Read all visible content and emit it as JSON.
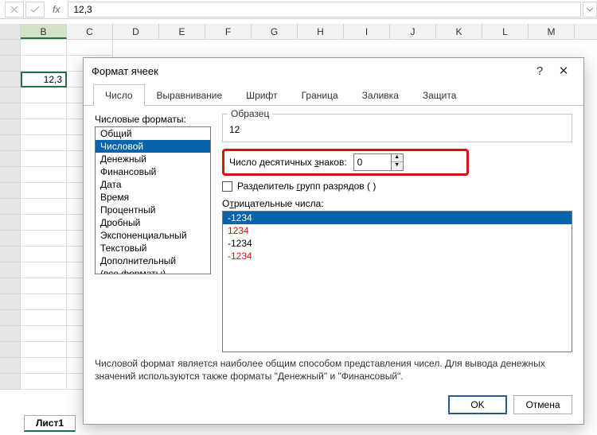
{
  "formula_bar": {
    "value": "12,3",
    "fx": "fx"
  },
  "columns": [
    "B",
    "C",
    "D",
    "E",
    "F",
    "G",
    "H",
    "I",
    "J",
    "K",
    "L",
    "M"
  ],
  "active_cell_value": "12,3",
  "sheet_tab": "Лист1",
  "dialog": {
    "title": "Формат ячеек",
    "help": "?",
    "close": "✕",
    "tabs": [
      "Число",
      "Выравнивание",
      "Шрифт",
      "Граница",
      "Заливка",
      "Защита"
    ],
    "active_tab": 0,
    "num_formats_label": "Числовые форматы:",
    "num_formats": [
      "Общий",
      "Числовой",
      "Денежный",
      "Финансовый",
      "Дата",
      "Время",
      "Процентный",
      "Дробный",
      "Экспоненциальный",
      "Текстовый",
      "Дополнительный",
      "(все форматы)"
    ],
    "num_formats_selected": 1,
    "sample_label": "Образец",
    "sample_value": "12",
    "decimal_label_pre": "Число десятичных ",
    "decimal_label_u": "з",
    "decimal_label_post": "наков:",
    "decimal_value": "0",
    "sep_label_pre": "Разделитель ",
    "sep_label_u": "г",
    "sep_label_post": "рупп разрядов ( )",
    "neg_label_pre": "О",
    "neg_label_u": "т",
    "neg_label_post": "рицательные числа:",
    "neg_items": [
      {
        "text": "-1234",
        "red": false,
        "sel": true
      },
      {
        "text": "1234",
        "red": true,
        "sel": false
      },
      {
        "text": "-1234",
        "red": false,
        "sel": false
      },
      {
        "text": "-1234",
        "red": true,
        "sel": false
      }
    ],
    "description": "Числовой формат является наиболее общим способом представления чисел. Для вывода денежных значений используются также форматы \"Денежный\" и \"Финансовый\".",
    "ok": "OK",
    "cancel": "Отмена"
  }
}
